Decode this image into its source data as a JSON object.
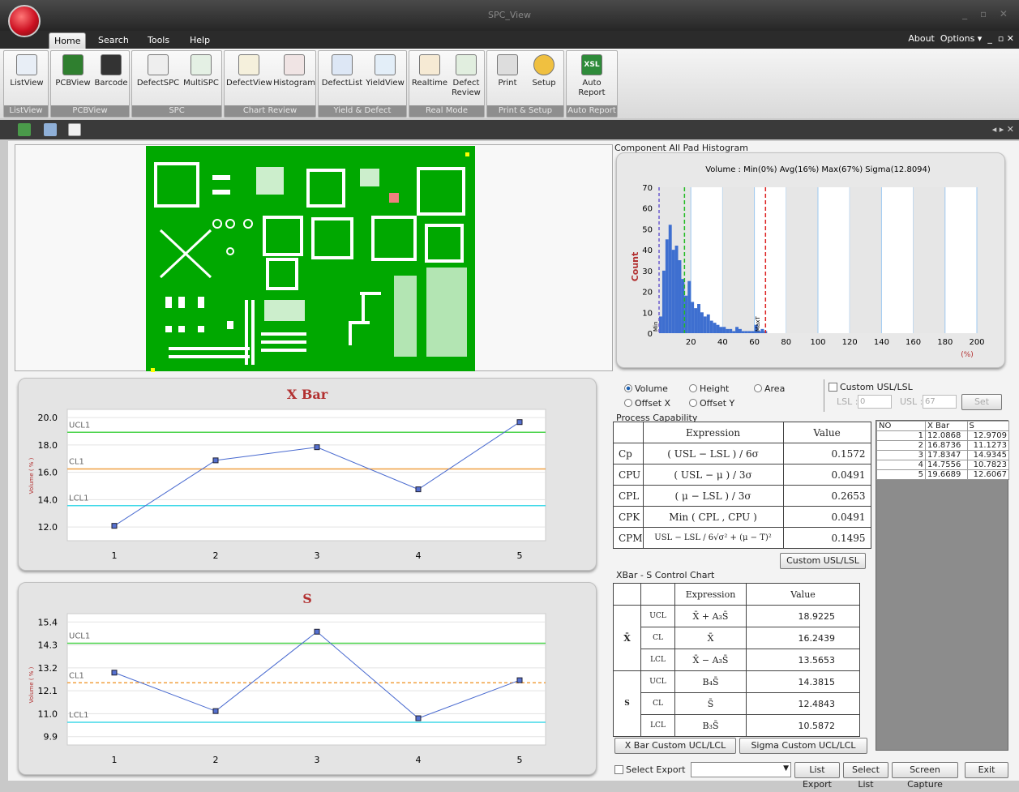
{
  "window": {
    "title": "SPC_View"
  },
  "menu": {
    "items": [
      "Home",
      "Search",
      "Tools",
      "Help"
    ],
    "about": "About",
    "options": "Options"
  },
  "ribbon": {
    "groups": [
      {
        "label": "ListView",
        "buttons": [
          "ListView"
        ]
      },
      {
        "label": "PCBView",
        "buttons": [
          "PCBView",
          "Barcode"
        ]
      },
      {
        "label": "SPC",
        "buttons": [
          "DefectSPC",
          "MultiSPC"
        ]
      },
      {
        "label": "Chart Review",
        "buttons": [
          "DefectView",
          "Histogram"
        ]
      },
      {
        "label": "Yield & Defect",
        "buttons": [
          "DefectList",
          "YieldView"
        ]
      },
      {
        "label": "Real Mode",
        "buttons": [
          "Realtime",
          "Defect Review"
        ]
      },
      {
        "label": "Print & Setup",
        "buttons": [
          "Print",
          "Setup"
        ]
      },
      {
        "label": "Auto Report",
        "buttons": [
          "Auto Report"
        ]
      }
    ]
  },
  "histogram": {
    "header": "Component All Pad Histogram",
    "summary": "Volume : Min(0%) Avg(16%) Max(67%)  Sigma(12.8094)",
    "ylabel": "Count",
    "xunit": "(%)",
    "y_ticks": [
      "70",
      "60",
      "50",
      "40",
      "30",
      "20",
      "10",
      "0"
    ],
    "x_ticks": [
      "20",
      "40",
      "60",
      "80",
      "100",
      "120",
      "140",
      "160",
      "180",
      "200"
    ],
    "min_label": "Min",
    "max_label": "MaxT"
  },
  "options": {
    "volume": "Volume",
    "height": "Height",
    "area": "Area",
    "offset_x": "Offset X",
    "offset_y": "Offset Y",
    "custom_usl_lsl": "Custom USL/LSL",
    "lsl_label": "LSL :",
    "lsl_value": "0",
    "usl_label": "USL :",
    "usl_value": "67",
    "set": "Set"
  },
  "process_capability": {
    "title": "Process Capability",
    "head_expr": "Expression",
    "head_value": "Value",
    "rows": [
      {
        "name": "Cp",
        "expr": "( USL − LSL ) / 6σ",
        "value": "0.1572"
      },
      {
        "name": "CPU",
        "expr": "( USL − μ ) / 3σ",
        "value": "0.0491"
      },
      {
        "name": "CPL",
        "expr": "( μ − LSL ) / 3σ",
        "value": "0.2653"
      },
      {
        "name": "CPK",
        "expr": "Min ( CPL , CPU )",
        "value": "0.0491"
      },
      {
        "name": "CPM",
        "expr": "USL − LSL / 6√σ² + (μ − T)²",
        "value": "0.1495"
      }
    ],
    "custom_button": "Custom USL/LSL"
  },
  "xbar_s_table": {
    "title": "XBar - S Control Chart",
    "head_expr": "Expression",
    "head_value": "Value",
    "xbar_label": "X̄",
    "s_label": "S",
    "rows": [
      {
        "k": "UCL",
        "expr": "X̄ + A₃S̄",
        "value": "18.9225"
      },
      {
        "k": "CL",
        "expr": "X̄",
        "value": "16.2439"
      },
      {
        "k": "LCL",
        "expr": "X̄ − A₃S̄",
        "value": "13.5653"
      },
      {
        "k": "UCL",
        "expr": "B₄S̄",
        "value": "14.3815"
      },
      {
        "k": "CL",
        "expr": "S̄",
        "value": "12.4843"
      },
      {
        "k": "LCL",
        "expr": "B₃S̄",
        "value": "10.5872"
      }
    ],
    "xbar_button": "X Bar Custom UCL/LCL",
    "sigma_button": "Sigma Custom UCL/LCL"
  },
  "data_grid": {
    "headers": [
      "NO",
      "X Bar",
      "S"
    ],
    "rows": [
      [
        "1",
        "12.0868",
        "12.9709"
      ],
      [
        "2",
        "16.8736",
        "11.1273"
      ],
      [
        "3",
        "17.8347",
        "14.9345"
      ],
      [
        "4",
        "14.7556",
        "10.7823"
      ],
      [
        "5",
        "19.6689",
        "12.6067"
      ]
    ]
  },
  "xbar_chart": {
    "title": "X Bar",
    "ylabel": "Volume ( % )",
    "y_ticks": [
      "20.0",
      "18.0",
      "16.0",
      "14.0",
      "12.0"
    ],
    "ucl": "UCL1",
    "cl": "CL1",
    "lcl": "LCL1"
  },
  "s_chart": {
    "title": "S",
    "ylabel": "Volume ( % )",
    "y_ticks": [
      "15.4",
      "14.3",
      "13.2",
      "12.1",
      "11.0",
      "9.9"
    ],
    "ucl": "UCL1",
    "cl": "CL1",
    "lcl": "LCL1"
  },
  "footer": {
    "select_export": "Select Export",
    "list_export": "List Export",
    "select_list": "Select List",
    "screen_capture": "Screen Capture",
    "exit": "Exit"
  },
  "chart_data": [
    {
      "type": "line",
      "title": "X Bar",
      "ylabel": "Volume ( % )",
      "x": [
        1,
        2,
        3,
        4,
        5
      ],
      "values": [
        12.0868,
        16.8736,
        17.8347,
        14.7556,
        19.6689
      ],
      "ucl": 18.9225,
      "cl": 16.2439,
      "lcl": 13.5653,
      "ylim": [
        11.0,
        20.6
      ]
    },
    {
      "type": "line",
      "title": "S",
      "ylabel": "Volume ( % )",
      "x": [
        1,
        2,
        3,
        4,
        5
      ],
      "values": [
        12.9709,
        11.1273,
        14.9345,
        10.7823,
        12.6067
      ],
      "ucl": 14.3815,
      "cl": 12.4843,
      "lcl": 10.5872,
      "ylim": [
        9.5,
        15.8
      ]
    },
    {
      "type": "area",
      "title": "Volume : Min(0%) Avg(16%) Max(67%)  Sigma(12.8094)",
      "ylabel": "Count",
      "xlabel": "(%)",
      "xlim": [
        0,
        200
      ],
      "ylim": [
        0,
        70
      ],
      "x": [
        1,
        3,
        5,
        7,
        9,
        11,
        13,
        15,
        17,
        19,
        21,
        23,
        25,
        27,
        29,
        31,
        33,
        35,
        37,
        39,
        41,
        43,
        45,
        47,
        49,
        51,
        53,
        55,
        57,
        59,
        61,
        63,
        65,
        67
      ],
      "values": [
        8,
        30,
        45,
        52,
        40,
        42,
        35,
        26,
        18,
        25,
        15,
        12,
        14,
        10,
        8,
        9,
        6,
        5,
        4,
        3,
        3,
        2,
        2,
        1,
        3,
        2,
        1,
        1,
        1,
        1,
        4,
        1,
        2,
        1
      ],
      "min": 0,
      "avg": 16,
      "max": 67
    }
  ]
}
